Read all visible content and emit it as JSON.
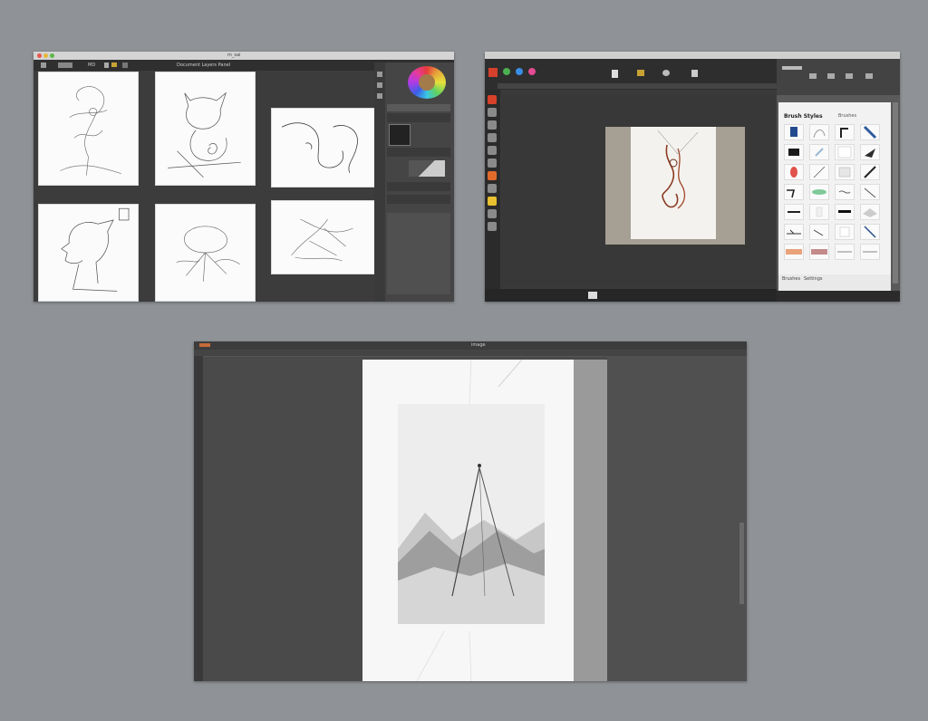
{
  "window1": {
    "title": "m_sai",
    "toolbar_label": "Document Layers Panel",
    "toolbar_value": "MD",
    "sketches": [
      "figure-sketch",
      "cat-sketch",
      "face-sketch",
      "profile-sketch",
      "flower-sketch",
      "branch-sketch"
    ]
  },
  "window2": {
    "panel_title": "Brush Styles",
    "panel_tab": "Brushes",
    "footer_labels": [
      "Brushes",
      "Settings"
    ],
    "accent_color": "#d7402b"
  },
  "window3": {
    "canvas_title": "image"
  }
}
